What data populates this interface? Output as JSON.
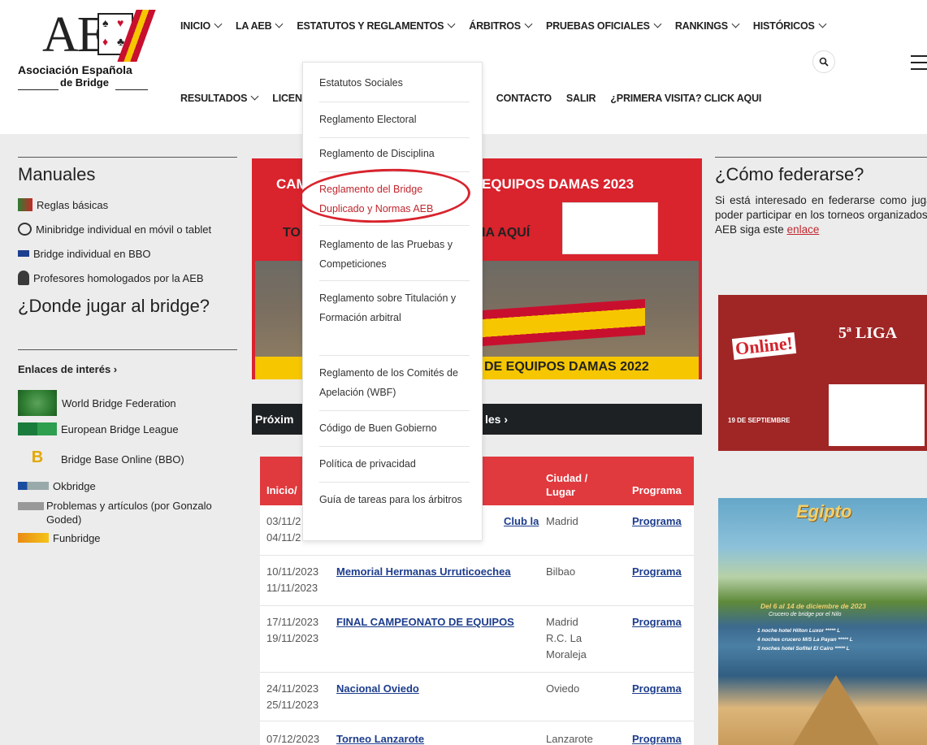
{
  "logo": {
    "letters": "AEB",
    "line1": "Asociación Española",
    "line2": "de Bridge"
  },
  "nav": {
    "row1": [
      "INICIO",
      "LA AEB",
      "ESTATUTOS Y REGLAMENTOS",
      "ÁRBITROS",
      "PRUEBAS OFICIALES",
      "RANKINGS",
      "HISTÓRICOS"
    ],
    "row2": [
      "RESULTADOS",
      "LICEN",
      "CONTACTO",
      "SALIR",
      "¿PRIMERA VISITA? CLICK AQUI"
    ],
    "search_icon": "search-icon",
    "menu_icon": "hamburger-icon"
  },
  "dropdown": {
    "items": [
      "Estatutos Sociales",
      "Reglamento Electoral",
      "Reglamento de Disciplina",
      "Reglamento del Bridge Duplicado y Normas AEB",
      "Reglamento de las Pruebas y Competiciones",
      "Reglamento sobre Titulación y Formación arbitral",
      "Reglamento de los Comités de Apelación (WBF)",
      "Código de Buen Gobierno",
      "Política de privacidad",
      "Guía de tareas para los árbitros"
    ],
    "active_index": 3
  },
  "manuales": {
    "title": "Manuales",
    "links": [
      "Reglas básicas",
      "Minibridge individual en móvil o tablet",
      "Bridge individual en BBO",
      "Profesores homologados por la AEB"
    ]
  },
  "donde": {
    "title": "¿Donde jugar al bridge?"
  },
  "enlaces": {
    "title": "Enlaces de interés ›",
    "links": [
      "World Bridge Federation",
      "European Bridge League",
      "Bridge Base Online (BBO)",
      "Okbridge",
      "Problemas y artículos (por Gonzalo Goded)",
      "Funbridge"
    ]
  },
  "promo": {
    "line1a": "CAM",
    "line1b": "EQUIPOS DAMAS 2023",
    "line2a": "TO",
    "line2b": "IA AQUÍ",
    "footer": "DE EQUIPOS DAMAS 2022"
  },
  "events": {
    "bar_a": "Próxim",
    "bar_b": "les ›",
    "headers": {
      "inicio": "Inicio/",
      "ciudad": "Ciudad / Lugar",
      "programa": "Programa"
    },
    "rows": [
      {
        "d1": "03/11/2",
        "d2": "04/11/2",
        "name": "Club la",
        "city": "Madrid",
        "prog": "Programa"
      },
      {
        "d1": "10/11/2023",
        "d2": "11/11/2023",
        "name": "Memorial Hermanas Urruticoechea",
        "city": "Bilbao",
        "prog": "Programa"
      },
      {
        "d1": "17/11/2023",
        "d2": "19/11/2023",
        "name": "FINAL CAMPEONATO DE EQUIPOS",
        "city": "Madrid",
        "city2": "R.C. La",
        "city3": "Moraleja",
        "prog": "Programa"
      },
      {
        "d1": "24/11/2023",
        "d2": "25/11/2023",
        "name": "Nacional Oviedo",
        "city": "Oviedo",
        "prog": "Programa"
      },
      {
        "d1": "07/12/2023",
        "d2": "",
        "name": "Torneo Lanzarote",
        "city": "Lanzarote",
        "prog": "Programa"
      }
    ]
  },
  "federarse": {
    "title": "¿Cómo federarse?",
    "text": "Si está interesado en federarse como jugador y poder participar en los torneos organizados por la AEB siga este",
    "link": "enlace"
  },
  "liga": {
    "online": "Online!",
    "title": "5ª LIGA",
    "date": "19 DE SEPTIEMBRE"
  },
  "egipto": {
    "title": "Egipto",
    "dates": "Del 6 al 14 de diciembre de 2023",
    "sub": "Crucero de bridge por el Nilo",
    "l1": "1 noche hotel Hilton Luxor ***** L",
    "l2": "4 noches crucero M/S La Payan ***** L",
    "l3": "3 noches hotel Sofitel El Cairo ***** L"
  },
  "colors": {
    "brand_red": "#d9232d",
    "link_blue": "#1c3c8c",
    "dark_bar": "#1d2124"
  }
}
